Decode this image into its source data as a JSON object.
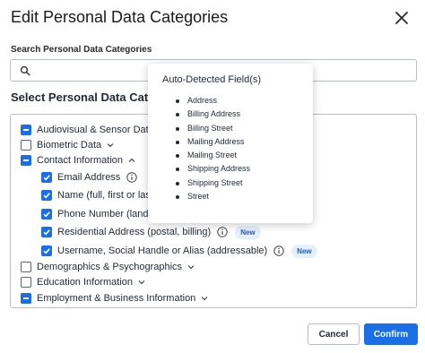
{
  "dialog": {
    "title": "Edit Personal Data Categories",
    "close_icon": "close-icon"
  },
  "search": {
    "label": "Search Personal Data Categories",
    "placeholder": "",
    "value": "",
    "icon": "search-icon"
  },
  "list": {
    "title": "Select Personal Data Categories",
    "items": [
      {
        "label": "Audiovisual & Sensor Data",
        "state": "indeterminate",
        "expand": "collapsed"
      },
      {
        "label": "Biometric Data",
        "state": "unchecked",
        "expand": "collapsed"
      },
      {
        "label": "Contact Information",
        "state": "indeterminate",
        "expand": "expanded"
      },
      {
        "label": "Email Address",
        "state": "checked",
        "info": true,
        "level": 1
      },
      {
        "label": "Name (full, first or last)",
        "state": "checked",
        "level": 1
      },
      {
        "label": "Phone Number (landline, mobile)",
        "state": "checked",
        "level": 1
      },
      {
        "label": "Residential Address (postal, billing)",
        "state": "checked",
        "info": true,
        "badge": "New",
        "level": 1
      },
      {
        "label": "Username, Social Handle or Alias (addressable)",
        "state": "checked",
        "info": true,
        "badge": "New",
        "level": 1
      },
      {
        "label": "Demographics & Psychographics",
        "state": "unchecked",
        "expand": "collapsed"
      },
      {
        "label": "Education Information",
        "state": "unchecked",
        "expand": "collapsed"
      },
      {
        "label": "Employment & Business Information",
        "state": "indeterminate",
        "expand": "collapsed"
      }
    ]
  },
  "popover": {
    "title": "Auto-Detected Field(s)",
    "fields": [
      "Address",
      "Billing Address",
      "Billing Street",
      "Mailing Address",
      "Mailing Street",
      "Shipping Address",
      "Shipping Street",
      "Street"
    ]
  },
  "buttons": {
    "cancel": "Cancel",
    "confirm": "Confirm"
  },
  "colors": {
    "accent": "#1a6ee6",
    "badge_bg": "#e6effc",
    "badge_text": "#1a5fc8",
    "border": "#b9bec6"
  }
}
